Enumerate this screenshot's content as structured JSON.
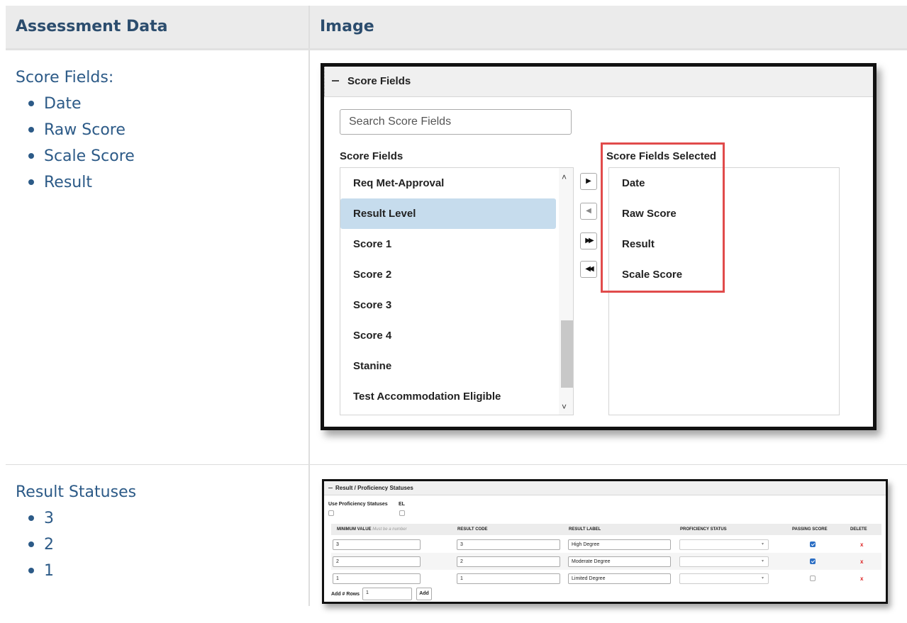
{
  "table": {
    "headers": [
      "Assessment Data",
      "Image"
    ],
    "rows": [
      {
        "label": "Score Fields:",
        "items": [
          "Date",
          "Raw Score",
          "Scale Score",
          "Result"
        ]
      },
      {
        "label": "Result Statuses",
        "items": [
          "3",
          "2",
          "1"
        ]
      }
    ]
  },
  "score_fields_panel": {
    "title": "Score Fields",
    "search_placeholder": "Search Score Fields",
    "available_label": "Score Fields",
    "selected_label": "Score Fields Selected",
    "available": [
      "Req Met-Approval",
      "Result Level",
      "Score 1",
      "Score 2",
      "Score 3",
      "Score 4",
      "Stanine",
      "Test Accommodation Eligible"
    ],
    "highlighted_item": "Result Level",
    "selected": [
      "Date",
      "Raw Score",
      "Result",
      "Scale Score"
    ],
    "buttons": {
      "move_right": "▶",
      "move_left": "◀",
      "move_all_right": "▶▶",
      "move_all_left": "◀◀"
    },
    "highlight_color": "#e14b4b"
  },
  "result_statuses_panel": {
    "title": "Result / Proficiency Statuses",
    "use_proficiency_label": "Use Proficiency Statuses",
    "el_label": "EL",
    "columns": {
      "min_value": "MINIMUM VALUE",
      "min_value_hint": "Must be a number",
      "result_code": "RESULT CODE",
      "result_label": "RESULT LABEL",
      "proficiency_status": "PROFICIENCY STATUS",
      "passing_score": "PASSING SCORE",
      "delete": "DELETE"
    },
    "rows": [
      {
        "min": "3",
        "code": "3",
        "label": "High Degree",
        "passing": true
      },
      {
        "min": "2",
        "code": "2",
        "label": "Moderate Degree",
        "passing": true
      },
      {
        "min": "1",
        "code": "1",
        "label": "Limited Degree",
        "passing": false
      }
    ],
    "delete_glyph": "x",
    "add_rows_label": "Add # Rows",
    "add_rows_value": "1",
    "add_button": "Add"
  }
}
